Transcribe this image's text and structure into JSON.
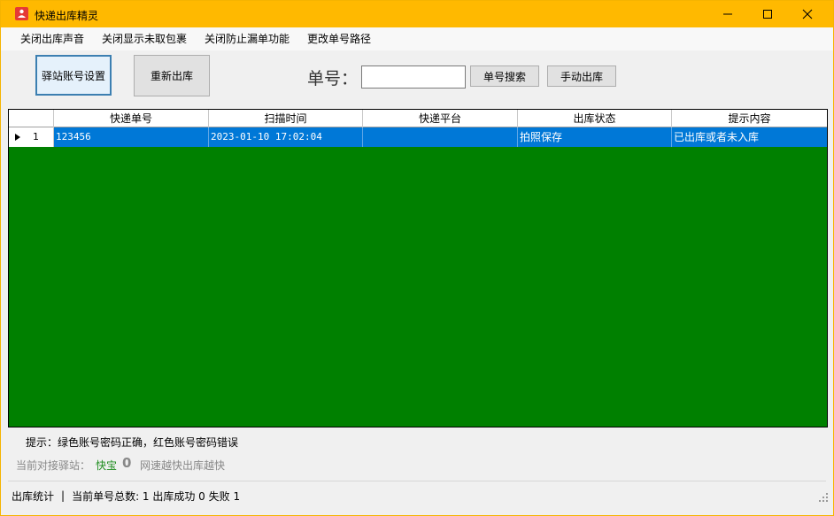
{
  "window": {
    "title": "快递出库精灵",
    "accent_color": "#ffb900"
  },
  "menu": [
    {
      "label": "关闭出库声音"
    },
    {
      "label": "关闭显示未取包裹"
    },
    {
      "label": "关闭防止漏单功能"
    },
    {
      "label": "更改单号路径"
    }
  ],
  "toolbar": {
    "station_settings_label": "驿站账号设置",
    "restock_label": "重新出库",
    "tracking_label": "单号：",
    "tracking_value": "",
    "search_label": "单号搜索",
    "manual_out_label": "手动出库"
  },
  "grid": {
    "background_color": "#008000",
    "columns": [
      "快递单号",
      "扫描时间",
      "快递平台",
      "出库状态",
      "提示内容"
    ],
    "rows": [
      {
        "index": "1",
        "cells": [
          "123456",
          "2023-01-10 17:02:04",
          "",
          "拍照保存",
          "已出库或者未入库"
        ],
        "selected": true
      }
    ]
  },
  "info": {
    "tip": "提示：绿色账号密码正确，红色账号密码错误",
    "station_label": "当前对接驿站：",
    "station_name": "快宝",
    "station_count": "0",
    "station_note": "网速越快出库越快"
  },
  "status": {
    "label": "出库统计",
    "separator": "|",
    "total_text": "当前单号总数:  1 出库成功 0 失败 1"
  }
}
